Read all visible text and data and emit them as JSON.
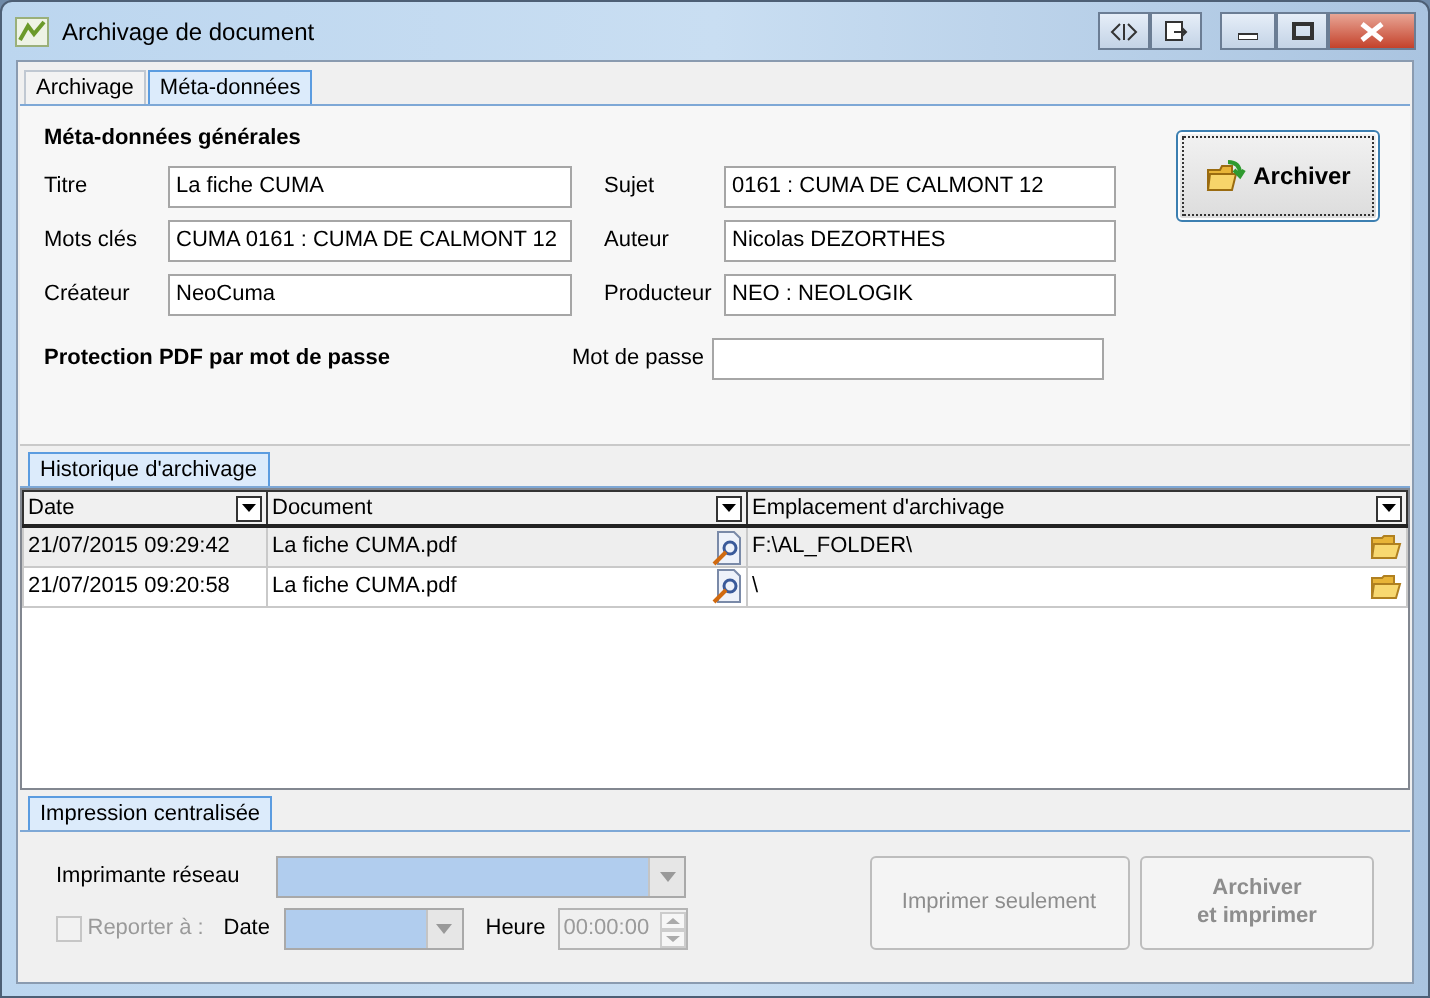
{
  "window": {
    "title": "Archivage de document"
  },
  "tabs": [
    {
      "label": "Archivage",
      "selected": false
    },
    {
      "label": "Méta-données",
      "selected": true
    }
  ],
  "metadata": {
    "section_title": "Méta-données générales",
    "fields": [
      {
        "label": "Titre",
        "value": "La fiche CUMA"
      },
      {
        "label": "Sujet",
        "value": "0161 : CUMA DE CALMONT 12"
      },
      {
        "label": "Mots clés",
        "value": "CUMA 0161 : CUMA DE CALMONT 12"
      },
      {
        "label": "Auteur",
        "value": "Nicolas DEZORTHES"
      },
      {
        "label": "Créateur",
        "value": "NeoCuma"
      },
      {
        "label": "Producteur",
        "value": "NEO : NEOLOGIK"
      }
    ],
    "protection_title": "Protection PDF par mot de passe",
    "password_label": "Mot de passe",
    "archive_button": "Archiver"
  },
  "history": {
    "tab": "Historique d'archivage",
    "columns": [
      "Date",
      "Document",
      "Emplacement d'archivage"
    ],
    "rows": [
      {
        "date": "21/07/2015 09:29:42",
        "document": "La fiche CUMA.pdf",
        "location": "F:\\AL_FOLDER\\"
      },
      {
        "date": "21/07/2015 09:20:58",
        "document": "La fiche CUMA.pdf",
        "location": "\\"
      }
    ]
  },
  "print": {
    "tab": "Impression centralisée",
    "printer_label": "Imprimante réseau",
    "report": {
      "label": "Reporter à :",
      "checked": false,
      "disabled": true
    },
    "date_label": "Date",
    "time_label": "Heure",
    "time_value": "00:00:00",
    "buttons": [
      {
        "label": "Imprimer seulement",
        "bold": false,
        "disabled": true
      },
      {
        "label": "Archiver\net imprimer",
        "bold": true,
        "disabled": true
      }
    ]
  }
}
